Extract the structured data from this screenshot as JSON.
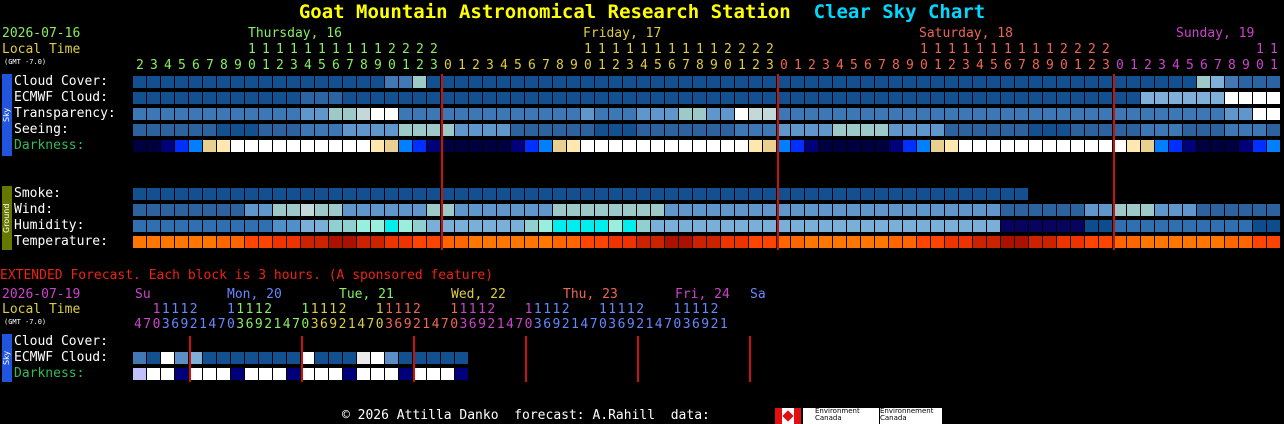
{
  "title": {
    "station": "Goat Mountain Astronomical Research Station",
    "chart": "Clear Sky Chart"
  },
  "header": {
    "date": "2026-07-16",
    "local_time": "Local Time",
    "gmt": "(GMT -7.0)",
    "days": [
      {
        "label": "Thursday, 16",
        "color": "#88ee66"
      },
      {
        "label": "Friday, 17",
        "color": "#ddcc44"
      },
      {
        "label": "Saturday, 18",
        "color": "#ee6655"
      },
      {
        "label": "Sunday, 19",
        "color": "#cc44cc"
      }
    ],
    "hours_start": 2,
    "hours_count": 72
  },
  "sky_rows": [
    {
      "label": "Cloud Cover:",
      "key": "cloud"
    },
    {
      "label": "ECMWF Cloud:",
      "key": "ecmwf"
    },
    {
      "label": "Transparency:",
      "key": "transp"
    },
    {
      "label": "Seeing:",
      "key": "seeing"
    },
    {
      "label": "Darkness:",
      "key": "dark"
    }
  ],
  "ground_rows": [
    {
      "label": "Smoke:",
      "key": "smoke"
    },
    {
      "label": "Wind:",
      "key": "wind"
    },
    {
      "label": "Humidity:",
      "key": "humid"
    },
    {
      "label": "Temperature:",
      "key": "temp"
    }
  ],
  "sidebar": {
    "sky": "Sky",
    "ground": "Ground"
  },
  "extended": {
    "notice": "EXTENDED Forecast. Each block is 3 hours. (A sponsored feature)",
    "date": "2026-07-19",
    "local_time": "Local Time",
    "gmt": "(GMT -7.0)",
    "days": [
      {
        "label": "Su",
        "color": "#cc44cc"
      },
      {
        "label": "Mon, 20",
        "color": "#6688ff"
      },
      {
        "label": "Tue, 21",
        "color": "#88ee66"
      },
      {
        "label": "Wed, 22",
        "color": "#ddcc44"
      },
      {
        "label": "Thu, 23",
        "color": "#ee6655"
      },
      {
        "label": "Fri, 24",
        "color": "#cc44cc"
      },
      {
        "label": "Sa",
        "color": "#6688ff"
      }
    ],
    "hours": [
      4,
      7,
      10,
      13,
      16,
      19,
      22,
      1,
      4,
      7,
      10,
      13,
      16,
      19,
      22,
      1,
      4,
      7,
      10,
      13,
      16,
      19,
      22,
      1,
      4,
      7,
      10,
      13,
      16,
      19,
      22,
      1,
      4,
      7,
      10,
      13,
      16,
      19,
      22,
      1,
      4,
      7,
      10,
      13,
      16,
      19,
      22,
      1,
      4,
      7,
      10,
      13,
      16,
      19,
      22,
      1,
      4,
      7,
      10,
      13,
      16,
      19,
      22,
      1
    ],
    "rows": [
      {
        "label": "Cloud Cover:",
        "key": "cloud"
      },
      {
        "label": "ECMWF Cloud:",
        "key": "ecmwf"
      },
      {
        "label": "Darkness:",
        "key": "dark"
      }
    ]
  },
  "footer": {
    "text": "© 2026 Attilla Danko  forecast: A.Rahill  data:",
    "env1": "Environment\nCanada",
    "env2": "Environnement\nCanada"
  },
  "colors": {
    "bg": "#000000",
    "cloud_scale": [
      "#003f7f",
      "#13508f",
      "#2a64a3",
      "#4278b4",
      "#5b8dc6",
      "#7fb0da",
      "#9ec9c9",
      "#c3d9d9",
      "#ebebeb",
      "#ffffff"
    ],
    "transp_scale": [
      "#003f7f",
      "#2c639f",
      "#3c78b6",
      "#5f97cc",
      "#9ec9c9",
      "#c3d9d9",
      "#ffffff"
    ],
    "seeing_scale": [
      "#003f7f",
      "#13508f",
      "#2c639f",
      "#3c78b6",
      "#5f97cc",
      "#9ec9c9"
    ],
    "dark_scale": [
      "#000000",
      "#000040",
      "#00007a",
      "#0000c0",
      "#0030ff",
      "#0080ff",
      "#c0c0ff",
      "#e8d090",
      "#ffe8b0",
      "#ffffff"
    ],
    "wind_scale": [
      "#003f7f",
      "#2c639f",
      "#5f97cc",
      "#9ec9c9",
      "#c3d9d9"
    ],
    "humid_scale": [
      "#08035d",
      "#0d4d8d",
      "#3070b0",
      "#5090c8",
      "#7ab0d8",
      "#90d0d0",
      "#99eedd",
      "#00eeee"
    ],
    "temp_scale": [
      "#aa1100",
      "#cc2200",
      "#ee3300",
      "#ff4400",
      "#ff6600",
      "#ff7700"
    ],
    "day_divider": "#cc1111"
  },
  "grid": {
    "cloud": [
      1,
      2,
      1,
      1,
      1,
      1,
      2,
      2,
      2,
      1,
      2,
      2,
      1,
      4,
      3,
      2,
      1,
      3,
      4,
      6,
      1,
      1,
      1,
      1,
      1,
      1,
      1,
      2,
      2,
      1,
      1,
      1,
      1,
      1,
      1,
      2,
      2,
      3,
      4,
      3,
      2,
      2,
      4,
      4,
      3,
      2,
      2,
      2,
      2,
      2,
      2,
      2,
      2,
      2,
      1,
      1,
      2,
      1,
      1,
      1,
      1,
      1,
      1,
      1,
      2,
      2,
      1,
      1,
      1,
      1,
      2,
      3,
      3,
      1,
      1,
      1,
      1,
      1,
      1,
      1,
      1,
      1,
      1,
      1,
      1,
      1,
      1,
      1,
      1,
      1,
      1,
      1,
      1,
      1,
      1,
      1,
      1,
      1,
      1,
      1,
      1,
      1,
      1,
      1,
      1,
      1,
      1,
      1,
      1,
      1,
      1,
      1,
      1,
      1,
      1,
      1,
      1,
      1,
      1,
      1,
      1,
      1,
      1,
      1,
      1,
      1,
      1,
      1,
      1,
      1,
      1,
      1,
      1,
      1,
      1,
      1,
      1,
      1,
      1,
      1,
      1,
      1,
      1,
      1,
      1,
      1,
      1,
      1,
      1,
      1,
      1,
      1,
      1,
      1,
      1,
      1,
      1,
      1,
      1,
      1,
      1,
      1,
      1,
      1,
      1,
      1,
      1,
      1,
      1,
      1,
      1,
      1,
      1,
      1,
      1,
      1,
      1,
      1,
      1,
      1,
      1,
      1,
      1,
      1,
      1,
      1,
      1,
      1,
      1,
      1,
      1,
      1,
      1,
      1,
      1,
      1,
      1,
      1,
      1,
      1,
      1,
      1,
      1,
      1,
      1,
      1,
      1,
      1,
      1,
      1,
      1,
      1,
      1,
      1,
      1,
      1,
      1,
      1,
      1,
      1,
      1,
      1,
      1,
      1,
      1,
      1,
      1,
      1,
      1,
      1,
      1,
      1,
      1,
      1,
      1,
      1
    ],
    "ecmwf": [],
    "transp": [],
    "seeing": [],
    "dark": [],
    "smoke": [],
    "wind": [],
    "humid": [],
    "temp": []
  }
}
